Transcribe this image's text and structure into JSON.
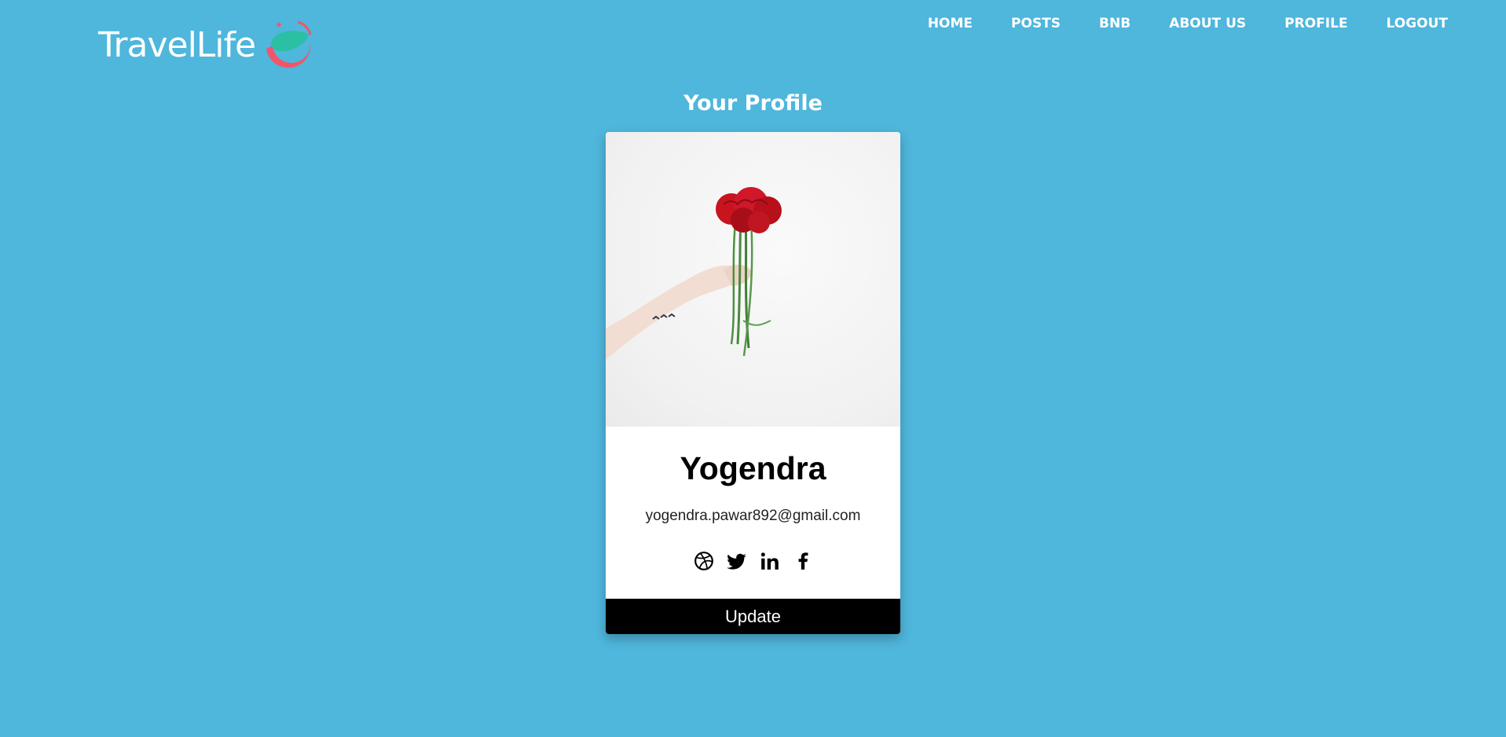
{
  "header": {
    "logo_text": "TravelLife",
    "nav": [
      {
        "label": "HOME"
      },
      {
        "label": "POSTS"
      },
      {
        "label": "BNB"
      },
      {
        "label": "ABOUT US"
      },
      {
        "label": "PROFILE"
      },
      {
        "label": "LOGOUT"
      }
    ]
  },
  "page": {
    "title": "Your Profile"
  },
  "profile": {
    "name": "Yogendra",
    "email": "yogendra.pawar892@gmail.com",
    "photo_icon": "red-carnations-bouquet-photo",
    "social_icons": [
      "dribbble-icon",
      "twitter-icon",
      "linkedin-icon",
      "facebook-icon"
    ],
    "update_label": "Update"
  },
  "colors": {
    "background": "#4fb6dc",
    "button": "#000000",
    "logo_accent_red": "#f0556a",
    "logo_accent_teal": "#2bbfa4"
  }
}
